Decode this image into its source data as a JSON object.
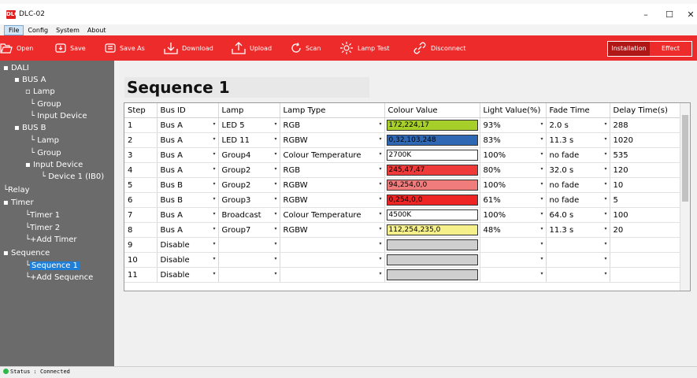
{
  "window": {
    "title": "DLC-02",
    "app_icon_text": "DLC",
    "controls": {
      "minimize": "–",
      "maximize": "☐",
      "close": "✕"
    }
  },
  "menu": [
    "File",
    "Config",
    "System",
    "About"
  ],
  "toolbar": {
    "open": "Open",
    "save": "Save",
    "save_as": "Save As",
    "download": "Download",
    "upload": "Upload",
    "scan": "Scan",
    "lamp_test": "Lamp Test",
    "disconnect": "Disconnect",
    "mode_installation": "Installation",
    "mode_effect": "Effect",
    "background_color": "#ee2b2b"
  },
  "tree": {
    "dali": "DALI",
    "bus_a": "BUS A",
    "bus_a_lamp": "Lamp",
    "bus_a_group": "Group",
    "bus_a_input": "Input Device",
    "bus_b": "BUS B",
    "bus_b_lamp": "Lamp",
    "bus_b_group": "Group",
    "bus_b_input": "Input Device",
    "device1": "Device 1 (IB0)",
    "relay": "Relay",
    "timer": "Timer",
    "timer1": "Timer 1",
    "timer2": "Timer 2",
    "add_timer": "+Add Timer",
    "sequence": "Sequence",
    "sequence1": "Sequence 1",
    "add_sequence": "+Add Sequence"
  },
  "main": {
    "title": "Sequence 1"
  },
  "table": {
    "headers": [
      "Step",
      "Bus ID",
      "Lamp",
      "Lamp Type",
      "Colour Value",
      "Light Value(%)",
      "Fade Time",
      "Delay Time(s)"
    ],
    "rows": [
      {
        "step": "1",
        "bus": "Bus A",
        "lamp": "LED 5",
        "type": "RGB",
        "colour": "172,224,17",
        "swatch": "#a6cf2a",
        "light": "93%",
        "fade": "2.0 s",
        "delay": "288"
      },
      {
        "step": "2",
        "bus": "Bus A",
        "lamp": "LED 11",
        "type": "RGBW",
        "colour": "0,32,103,248",
        "swatch": "#2e67b3",
        "light": "83%",
        "fade": "11.3 s",
        "delay": "1020"
      },
      {
        "step": "3",
        "bus": "Bus A",
        "lamp": "Group4",
        "type": "Colour Temperature",
        "colour": "2700K",
        "swatch": "#ffffff",
        "light": "100%",
        "fade": "no fade",
        "delay": "535"
      },
      {
        "step": "4",
        "bus": "Bus A",
        "lamp": "Group2",
        "type": "RGB",
        "colour": "245,47,47",
        "swatch": "#ef3a3a",
        "light": "80%",
        "fade": "32.0 s",
        "delay": "120"
      },
      {
        "step": "5",
        "bus": "Bus B",
        "lamp": "Group2",
        "type": "RGBW",
        "colour": "94,254,0,0",
        "swatch": "#f07c7c",
        "light": "100%",
        "fade": "no fade",
        "delay": "10"
      },
      {
        "step": "6",
        "bus": "Bus B",
        "lamp": "Group3",
        "type": "RGBW",
        "colour": "0,254,0,0",
        "swatch": "#ee2424",
        "light": "61%",
        "fade": "no fade",
        "delay": "5"
      },
      {
        "step": "7",
        "bus": "Bus A",
        "lamp": "Broadcast",
        "type": "Colour Temperature",
        "colour": "4500K",
        "swatch": "#ffffff",
        "light": "100%",
        "fade": "64.0 s",
        "delay": "100"
      },
      {
        "step": "8",
        "bus": "Bus A",
        "lamp": "Group7",
        "type": "RGBW",
        "colour": "112,254,235,0",
        "swatch": "#f6f08a",
        "light": "48%",
        "fade": "11.3 s",
        "delay": "20"
      },
      {
        "step": "9",
        "bus": "Disable",
        "lamp": "",
        "type": "",
        "colour": "",
        "swatch": "#cfcfcf",
        "light": "",
        "fade": "",
        "delay": ""
      },
      {
        "step": "10",
        "bus": "Disable",
        "lamp": "",
        "type": "",
        "colour": "",
        "swatch": "#cfcfcf",
        "light": "",
        "fade": "",
        "delay": ""
      },
      {
        "step": "11",
        "bus": "Disable",
        "lamp": "",
        "type": "",
        "colour": "",
        "swatch": "#cfcfcf",
        "light": "",
        "fade": "",
        "delay": ""
      }
    ]
  },
  "status": {
    "label": "Status",
    "sep": ":",
    "value": "Connected",
    "color": "#2fb74a"
  },
  "icons": {
    "open": "folder-icon",
    "save": "save-icon",
    "save_as": "save-as-icon",
    "download": "download-icon",
    "upload": "upload-icon",
    "scan": "scan-icon",
    "lamp_test": "lamp-icon",
    "disconnect": "link-icon"
  }
}
